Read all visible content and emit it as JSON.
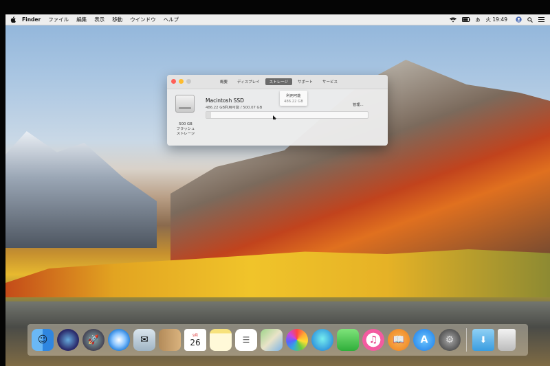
{
  "menubar": {
    "app": "Finder",
    "items": [
      "ファイル",
      "編集",
      "表示",
      "移動",
      "ウインドウ",
      "ヘルプ"
    ],
    "clock": "火 19:49",
    "input_method": "あ"
  },
  "window": {
    "tabs": [
      "概要",
      "ディスプレイ",
      "ストレージ",
      "サポート",
      "サービス"
    ],
    "active_tab_index": 2,
    "disk": {
      "name": "Macintosh SSD",
      "info": "486.22 GB利用可能 / 500.07 GB",
      "capacity_line1": "500 GB",
      "capacity_line2": "フラッシュ",
      "capacity_line3": "ストレージ"
    },
    "manage_label": "管理...",
    "tooltip_title": "利用可能",
    "tooltip_value": "486.22 GB",
    "used_fraction": 0.028
  },
  "dock": {
    "calendar_month": "9月",
    "calendar_day": "26",
    "icons": [
      "finder-icon",
      "siri-icon",
      "launchpad-icon",
      "safari-icon",
      "mail-icon",
      "contacts-icon",
      "calendar-icon",
      "notes-icon",
      "reminders-icon",
      "maps-icon",
      "photos-icon",
      "messages-icon",
      "facetime-icon",
      "itunes-icon",
      "ibooks-icon",
      "app-store-icon",
      "system-preferences-icon",
      "downloads-icon",
      "trash-icon"
    ],
    "colors": {
      "finder": "#4aa3f0",
      "siri": "#2a2a5a",
      "safari": "#2d8cf0",
      "itunes": "#f35ba0",
      "ibooks": "#f39a2b",
      "appstore": "#2a8cf4"
    }
  }
}
